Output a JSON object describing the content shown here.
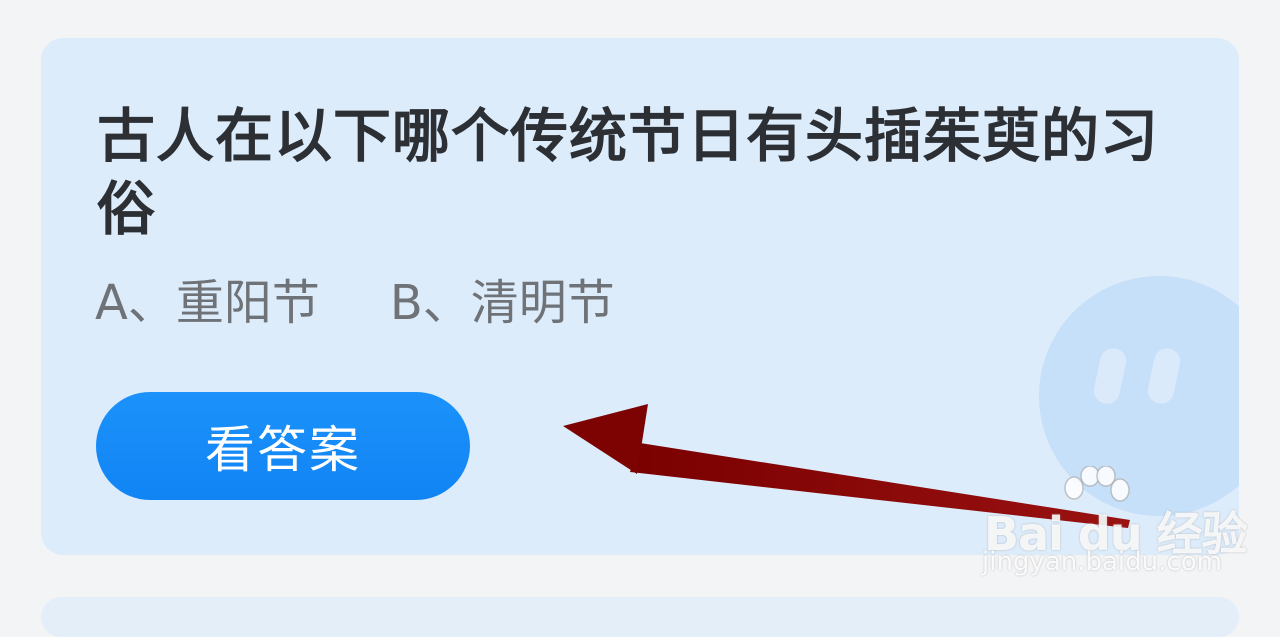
{
  "question": {
    "text": "古人在以下哪个传统节日有头插茱萸的习俗"
  },
  "options": [
    {
      "label": "A、重阳节"
    },
    {
      "label": "B、清明节"
    }
  ],
  "answer_button": {
    "label": "看答案"
  },
  "watermark": {
    "logo": "Bai  du 经验",
    "url": "jingyan.baidu.com"
  },
  "colors": {
    "page_bg": "#f3f4f6",
    "card_bg": "#ddecfb",
    "button": "#1488f7",
    "arrow": "#8a0b0b",
    "mascot": "#c6e0fa"
  },
  "icons": [
    "mascot-icon",
    "annotation-arrow-icon",
    "baidu-paw-icon"
  ]
}
